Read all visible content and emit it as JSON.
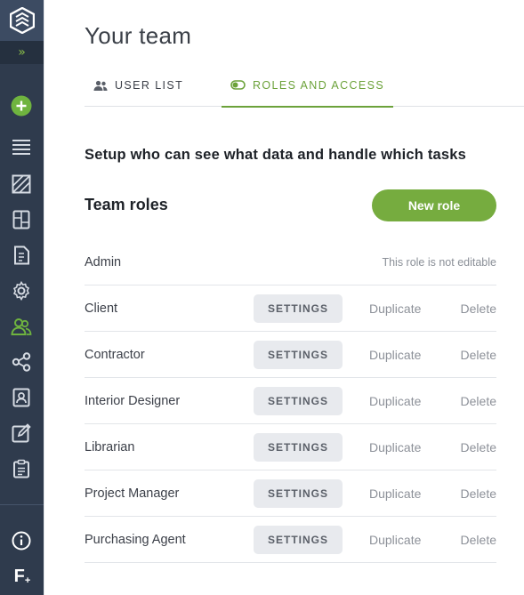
{
  "sidebar": {
    "logo_icon": "app-logo-icon",
    "expand_glyph": "»",
    "items": [
      {
        "name": "add-icon"
      },
      {
        "name": "list-icon"
      },
      {
        "name": "floorplan-icon"
      },
      {
        "name": "board-icon"
      },
      {
        "name": "invoice-icon"
      },
      {
        "name": "settings-icon"
      },
      {
        "name": "team-icon",
        "active": true
      },
      {
        "name": "share-icon"
      },
      {
        "name": "contacts-icon"
      },
      {
        "name": "edit-icon"
      },
      {
        "name": "clipboard-icon"
      }
    ],
    "info_icon": "info-icon",
    "brand_mark": "F"
  },
  "page": {
    "title": "Your team"
  },
  "tabs": [
    {
      "label": "USER LIST",
      "icon": "users-icon",
      "active": false
    },
    {
      "label": "ROLES AND ACCESS",
      "icon": "toggle-icon",
      "active": true
    }
  ],
  "setup_text": "Setup who can see what data and handle which tasks",
  "team_roles": {
    "heading": "Team roles",
    "new_role_label": "New role"
  },
  "roles": [
    {
      "name": "Admin",
      "note": "This role is not editable"
    },
    {
      "name": "Client",
      "settings_label": "SETTINGS",
      "duplicate_label": "Duplicate",
      "delete_label": "Delete"
    },
    {
      "name": "Contractor",
      "settings_label": "SETTINGS",
      "duplicate_label": "Duplicate",
      "delete_label": "Delete"
    },
    {
      "name": "Interior Designer",
      "settings_label": "SETTINGS",
      "duplicate_label": "Duplicate",
      "delete_label": "Delete"
    },
    {
      "name": "Librarian",
      "settings_label": "SETTINGS",
      "duplicate_label": "Duplicate",
      "delete_label": "Delete"
    },
    {
      "name": "Project Manager",
      "settings_label": "SETTINGS",
      "duplicate_label": "Duplicate",
      "delete_label": "Delete"
    },
    {
      "name": "Purchasing Agent",
      "settings_label": "SETTINGS",
      "duplicate_label": "Duplicate",
      "delete_label": "Delete"
    }
  ],
  "colors": {
    "accent": "#76ac3f",
    "sidebar": "#2f3b4d"
  }
}
